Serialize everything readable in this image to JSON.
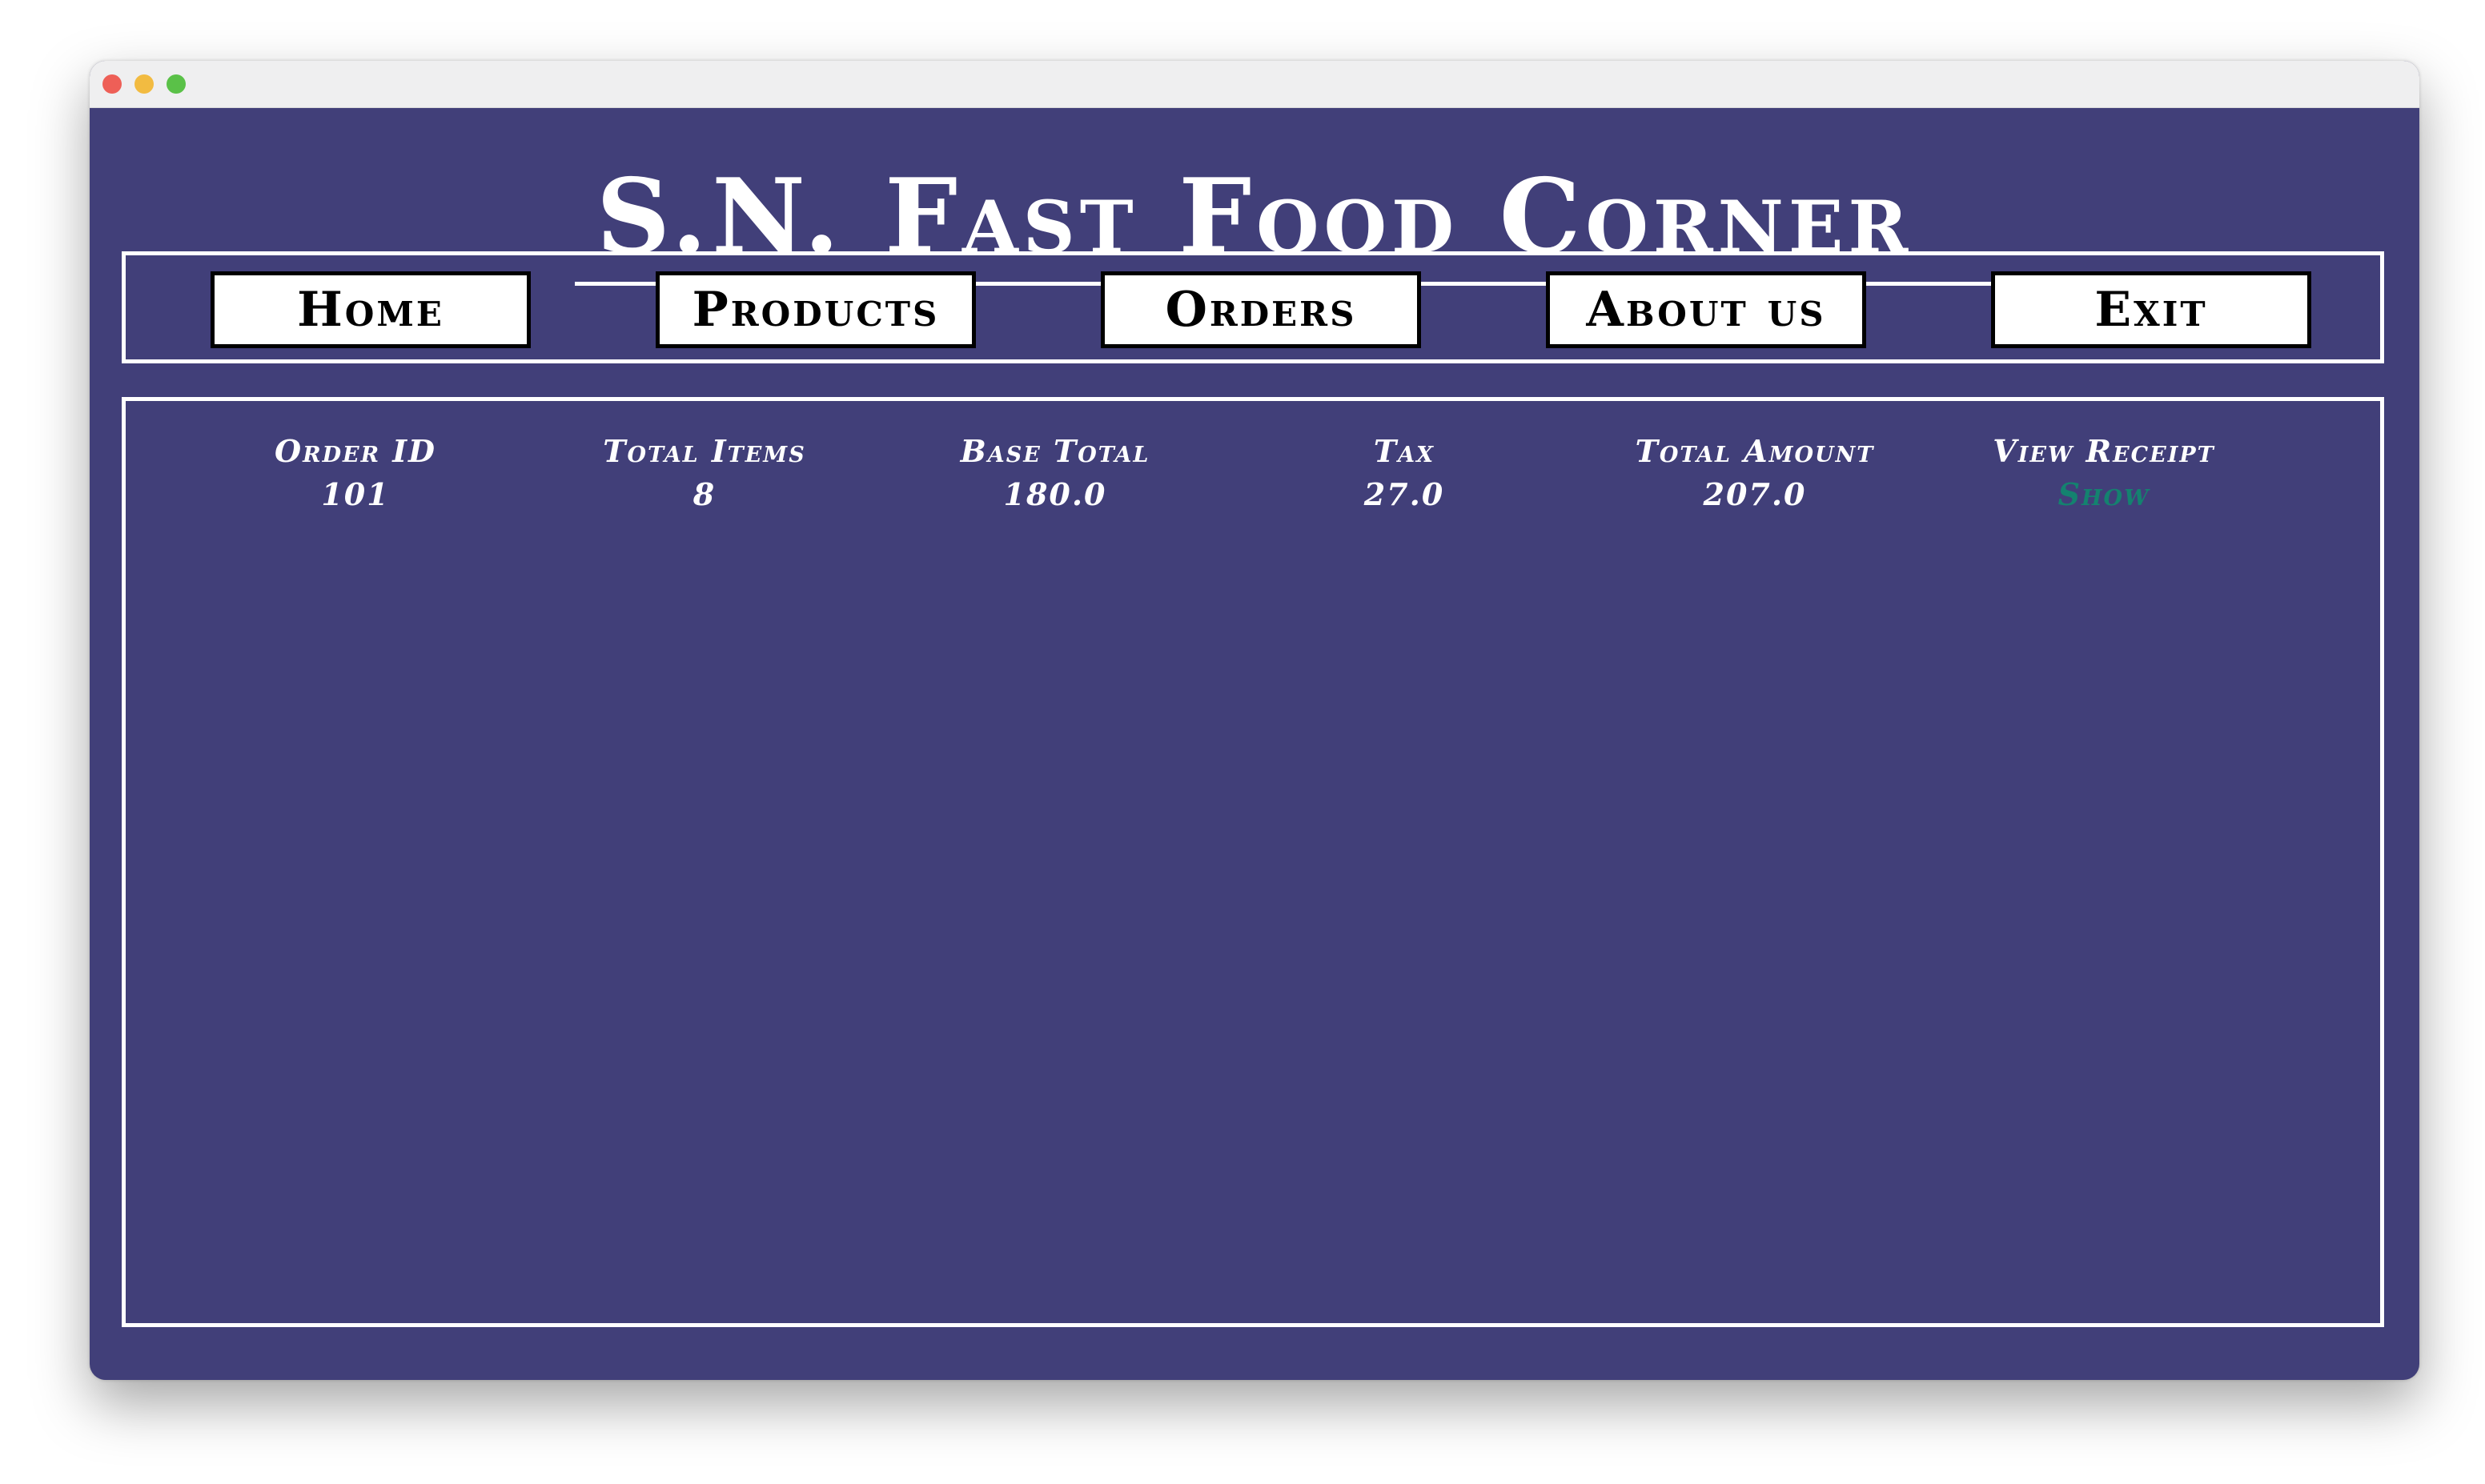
{
  "app": {
    "title": "S.N. Fast Food Corner"
  },
  "nav": {
    "items": [
      {
        "label": "Home"
      },
      {
        "label": "Products"
      },
      {
        "label": "Orders"
      },
      {
        "label": "About us"
      },
      {
        "label": "Exit"
      }
    ]
  },
  "orders": {
    "columns": [
      "Order ID",
      "Total Items",
      "Base Total",
      "Tax",
      "Total Amount",
      "View Receipt"
    ],
    "rows": [
      {
        "order_id": "101",
        "total_items": "8",
        "base_total": "180.0",
        "tax": "27.0",
        "total_amount": "207.0",
        "receipt_link": "Show"
      }
    ]
  },
  "colors": {
    "background": "#413f79",
    "text": "#ffffff",
    "link": "#14826f",
    "button_bg": "#ffffff",
    "button_border": "#000000"
  }
}
